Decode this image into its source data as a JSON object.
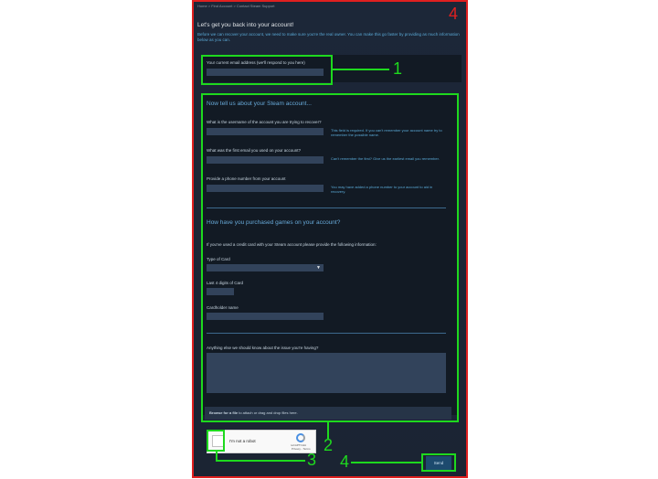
{
  "breadcrumb": "Home > Find Account > Contact Steam Support",
  "heading": "Let's get you back into your account!",
  "intro": "Before we can recover your account, we need to make sure you're the real owner. You can make this go faster by providing as much information below as you can.",
  "email_section": {
    "label": "Your current email address (we'll respond to you here)"
  },
  "account_section": {
    "title": "Now tell us about your Steam account...",
    "q_username": "What is the username of the account you are trying to recover?",
    "hint_username": "This field is required. If you can't remember your account name try to remember the possible name.",
    "q_first_email": "What was the first email you used on your account?",
    "hint_first_email": "Can't remember the first? Give us the earliest email you remember.",
    "q_phone": "Provide a phone number from your account",
    "hint_phone": "You may have added a phone number to your account to aid in recovery."
  },
  "purchase_section": {
    "title": "How have you purchased games on your account?",
    "intro": "If you've used a credit card with your Steam account please provide the following information:",
    "card_type_label": "Type of Card",
    "card_type_value": "",
    "last4_label": "Last 4 digits of Card",
    "cardholder_label": "Cardholder name"
  },
  "issue_section": {
    "label": "Anything else we should know about the issue you're having?"
  },
  "attach": {
    "browse": "Browse for a file",
    "rest": " to attach or drag and drop files here."
  },
  "captcha": {
    "label": "I'm not a robot",
    "brand": "reCAPTCHA",
    "links": "Privacy - Terms"
  },
  "send_button": "Send",
  "annotations": {
    "n1": "1",
    "n2": "2",
    "n3": "3",
    "n4a": "4",
    "n4b": "4"
  },
  "colors": {
    "panel": "#1b2433",
    "frame": "#e02020",
    "annotation": "#1ed91e",
    "input": "#32435b",
    "accent": "#5aa9d6"
  }
}
